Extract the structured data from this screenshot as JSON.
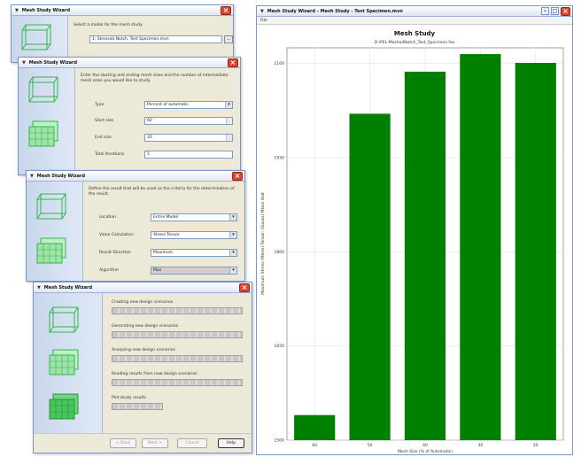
{
  "wizard": {
    "title": "Mesh Study Wizard",
    "w1": {
      "desc": "Select a model for the mesh study",
      "model_value": "1: Stressed Notch, Test Specimen.mvn"
    },
    "w2": {
      "desc": "Enter the starting and ending mesh sizes and the number of intermediate mesh sizes you would like to study.",
      "fields": [
        {
          "label": "Type",
          "value": "Percent of automatic"
        },
        {
          "label": "Start size",
          "value": "60"
        },
        {
          "label": "End size",
          "value": "20"
        },
        {
          "label": "Total Iterations",
          "value": "5"
        }
      ]
    },
    "w3": {
      "desc": "Define the result that will be used as the criteria for the determination of the result.",
      "fields": [
        {
          "label": "Location",
          "value": "Entire Model"
        },
        {
          "label": "Value Calculation",
          "value": "Stress Tensor"
        },
        {
          "label": "Result Direction",
          "value": "Maximum"
        },
        {
          "label": "Algorithm",
          "value": "Max"
        }
      ]
    },
    "w4": {
      "steps": [
        "Creating new design scenarios",
        "Generating new design scenarios",
        "Analyzing new design scenarios",
        "Reading results from new design scenarios",
        "Plot study results"
      ],
      "buttons": {
        "back": "< Back",
        "next": "Next >",
        "cancel": "Cancel",
        "help": "Help"
      }
    }
  },
  "graph_window": {
    "title": "Mesh Study Wizard - Mesh Study - Test Specimen.mvn",
    "menu": "File",
    "min_icon": "minimize-icon",
    "max_icon": "maximize-icon",
    "close_icon": "close-icon"
  },
  "chart_data": {
    "type": "bar",
    "title": "Mesh Study",
    "subtitle": "D:\\PEL-MeshedNotch_Test_Specimen.fex",
    "xlabel": "Mesh Size (% of Automatic)",
    "ylabel": "Maximum Stress (Mises) Tensor: (Gauss) Mises Stat",
    "categories": [
      "60",
      "50",
      "40",
      "30",
      "20"
    ],
    "values": [
      1540,
      2020,
      2087,
      2115,
      2101
    ],
    "ylim": [
      1500,
      2125
    ],
    "yticks": [
      "1500",
      "1650",
      "1800",
      "1950",
      "2100"
    ],
    "grid": true,
    "colors": {
      "bar": "#008000"
    }
  }
}
